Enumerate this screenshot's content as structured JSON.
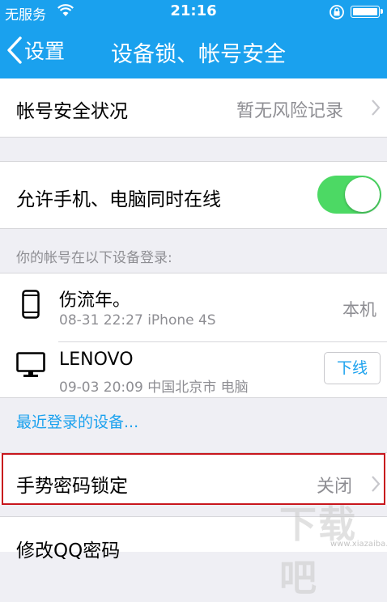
{
  "status_bar": {
    "carrier": "无服务",
    "time": "21:16"
  },
  "nav": {
    "back_label": "设置",
    "title": "设备锁、帐号安全"
  },
  "account_status": {
    "label": "帐号安全状况",
    "value": "暂无风险记录"
  },
  "dual_online": {
    "label": "允许手机、电脑同时在线",
    "enabled": true,
    "on_color": "#4cd964"
  },
  "devices": {
    "section_label": "你的帐号在以下设备登录:",
    "items": [
      {
        "icon": "phone-icon",
        "name": "伤流年。",
        "meta": "08-31 22:27  iPhone 4S",
        "tag": "本机"
      },
      {
        "icon": "monitor-icon",
        "name": "LENOVO",
        "meta": "09-03 20:09 中国北京市 电脑",
        "action": "下线"
      }
    ],
    "recent_link": "最近登录的设备..."
  },
  "gesture_lock": {
    "label": "手势密码锁定",
    "value": "关闭"
  },
  "change_password": {
    "label": "修改QQ密码"
  },
  "watermark": {
    "text": "下载吧",
    "sub": "www.xiazaiba.com"
  },
  "colors": {
    "header": "#1aa1ee",
    "link": "#1aa1ee",
    "highlight": "#c8161d"
  }
}
